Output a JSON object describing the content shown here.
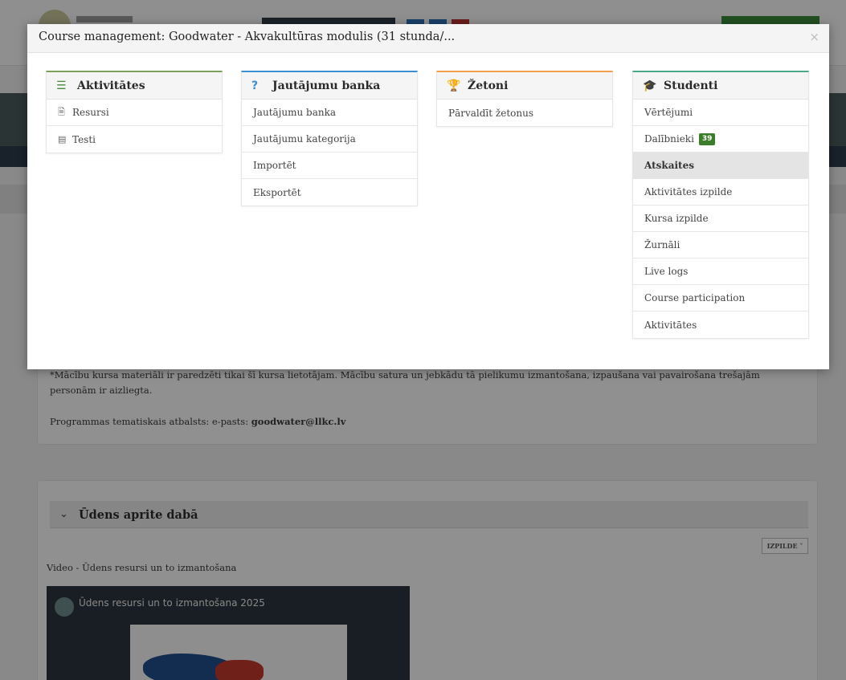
{
  "modal": {
    "title": "Course management: Goodwater - Akvakultūras modulis (31 stunda/...",
    "close_glyph": "×"
  },
  "panels": {
    "aktivitates": {
      "header": "Aktivitātes",
      "icon": "list-icon",
      "accent": "#7aa05a",
      "items": [
        {
          "label": "Resursi",
          "icon": "file-icon"
        },
        {
          "label": "Testi",
          "icon": "quiz-icon"
        }
      ]
    },
    "jautajumu_banka": {
      "header": "Jautājumu banka",
      "icon": "question-icon",
      "accent": "#3b8fd1",
      "items": [
        {
          "label": "Jautājumu banka"
        },
        {
          "label": "Jautājumu kategorija"
        },
        {
          "label": "Importēt"
        },
        {
          "label": "Eksportēt"
        }
      ]
    },
    "zetoni": {
      "header": "Žetoni",
      "icon": "trophy-icon",
      "accent": "#f0a04b",
      "items": [
        {
          "label": "Pārvaldīt žetonus"
        }
      ]
    },
    "studenti": {
      "header": "Studenti",
      "icon": "graduation-cap-icon",
      "accent": "#4aa88a",
      "items": [
        {
          "label": "Vērtējumi"
        },
        {
          "label": "Dalībnieki",
          "badge": "39"
        },
        {
          "label": "Atskaites",
          "active": true
        },
        {
          "label": "Aktivitātes izpilde"
        },
        {
          "label": "Kursa izpilde"
        },
        {
          "label": "Žurnāli"
        },
        {
          "label": "Live logs"
        },
        {
          "label": "Course participation"
        },
        {
          "label": "Aktivitātes"
        }
      ]
    }
  },
  "background": {
    "notice_line1": "*Mācību kursa materiāli ir paredzēti tikai šī kursa lietotājam. Mācību satura un jebkādu tā pielikumu izmantošana, izpaušana vai pavairošana trešajām",
    "notice_line2": "personām ir aizliegta.",
    "support_prefix": "Programmas tematiskais atbalsts: e-pasts: ",
    "support_email": "goodwater@llkc.lv",
    "section_title": "Ūdens aprite dabā",
    "completion_button": "IZPILDE",
    "video_label": "Video - Ūdens resursi un to izmantošana",
    "video_title": "Ūdens resursi un to izmantošana 2025"
  }
}
